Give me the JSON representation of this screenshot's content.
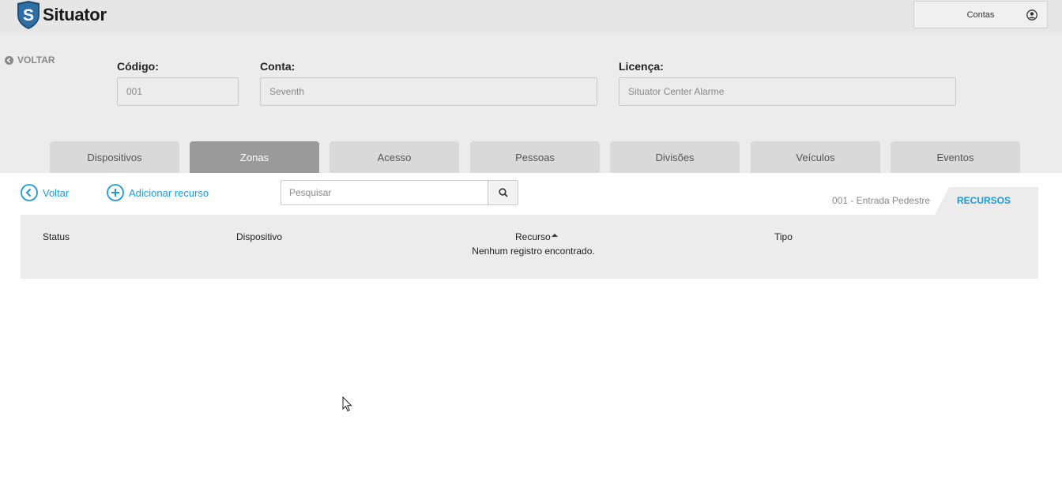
{
  "app": {
    "brand": "Situator",
    "brand_initial": "S"
  },
  "topbar": {
    "account_label": "Contas"
  },
  "header": {
    "back_label": "VOLTAR",
    "fields": {
      "codigo": {
        "label": "Código:",
        "value": "001"
      },
      "conta": {
        "label": "Conta:",
        "value": "Seventh"
      },
      "licenca": {
        "label": "Licença:",
        "value": "Situator Center Alarme"
      }
    }
  },
  "tabs": [
    {
      "label": "Dispositivos",
      "active": false
    },
    {
      "label": "Zonas",
      "active": true
    },
    {
      "label": "Acesso",
      "active": false
    },
    {
      "label": "Pessoas",
      "active": false
    },
    {
      "label": "Divisões",
      "active": false
    },
    {
      "label": "Veículos",
      "active": false
    },
    {
      "label": "Eventos",
      "active": false
    }
  ],
  "toolbar": {
    "back_label": "Voltar",
    "add_label": "Adicionar recurso",
    "search_placeholder": "Pesquisar"
  },
  "breadcrumb": {
    "zone": "001 - Entrada Pedestre",
    "section": "RECURSOS"
  },
  "table": {
    "columns": [
      "Status",
      "Dispositivo",
      "Recurso",
      "Tipo"
    ],
    "sorted_column": "Recurso",
    "empty_message": "Nenhum registro encontrado."
  },
  "colors": {
    "accent": "#1d9ad6",
    "active_tab": "#9a9a9a"
  }
}
